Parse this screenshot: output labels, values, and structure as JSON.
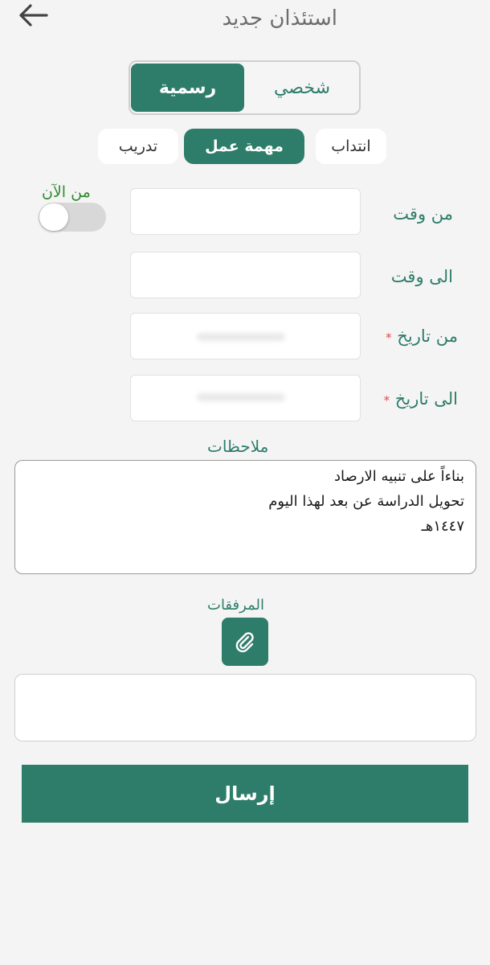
{
  "header": {
    "title": "استئذان جديد",
    "back_icon": "arrow-left-icon"
  },
  "type_segment": {
    "personal_label": "شخصي",
    "official_label": "رسمية",
    "selected": "رسمية"
  },
  "subtype_tabs": {
    "items": [
      "انتداب",
      "مهمة عمل",
      "تدريب"
    ],
    "selected": "مهمة عمل"
  },
  "form": {
    "from_time_label": "من وقت",
    "to_time_label": "الى وقت",
    "from_date_label": "من تاريخ",
    "to_date_label": "الى تاريخ",
    "required_mark": "*",
    "now_label": "من الآن",
    "now_toggle_on": false
  },
  "notes": {
    "label": "ملاحظات",
    "lines": [
      "بناءاً على تنبيه الارصاد",
      "تحويل الدراسة عن بعد لهذا اليوم",
      "١٤٤٧هـ"
    ]
  },
  "attachments": {
    "label": "المرفقات",
    "icon": "paperclip-icon"
  },
  "submit": {
    "label": "إرسال"
  },
  "colors": {
    "accent": "#2e7d6a",
    "now_label": "#2e8b2e",
    "required": "#e04a4a",
    "background": "#f4f4f4"
  }
}
